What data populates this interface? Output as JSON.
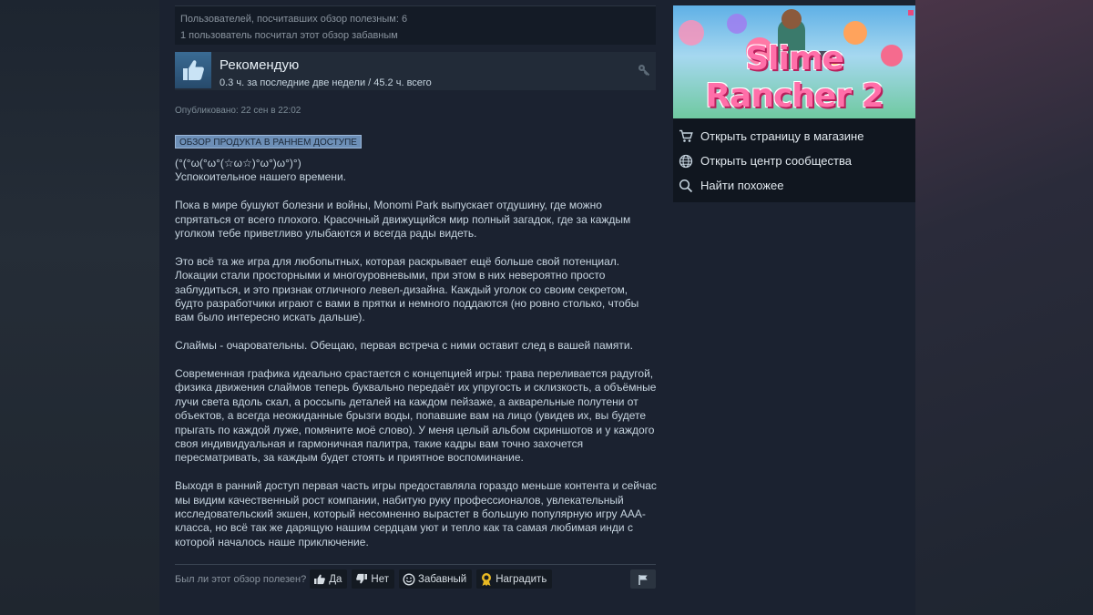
{
  "helpful": {
    "line1": "Пользователей, посчитавших обзор полезным: 6",
    "line2": "1 пользователь посчитал этот обзор забавным"
  },
  "recommendation": {
    "title": "Рекомендую",
    "hours": "0.3 ч. за последние две недели / 45.2 ч. всего",
    "thumb_icon": "thumbs-up-icon",
    "key_icon": "key-icon"
  },
  "posted": "Опубликовано: 22 сен в 22:02",
  "badge": "ОБЗОР ПРОДУКТА В РАННЕМ ДОСТУПЕ",
  "review": {
    "emote": "(°(°ω(°ω°(☆ω☆)°ω°)ω°)°)",
    "p0": "Успокоительное нашего времени.",
    "p1": "Пока в мире бушуют болезни и войны, Monomi Park выпускает отдушину, где можно спрятаться от всего плохого. Красочный движущийся мир полный загадок, где за каждым уголком тебе приветливо улыбаются и всегда рады видеть.",
    "p2": "Это всё та же игра для любопытных, которая раскрывает ещё больше свой потенциал. Локации стали просторными и многоуровневыми, при этом в них невероятно просто заблудиться, и это признак отличного левел-дизайна. Каждый уголок со своим секретом, будто разработчики играют с вами в прятки и немного поддаются (но ровно столько, чтобы вам было интересно искать дальше).",
    "p3": "Слаймы - очаровательны. Обещаю, первая встреча с ними оставит след в вашей памяти.",
    "p4": "Современная графика идеально срастается с концепцией игры: трава переливается радугой, физика движения слаймов теперь буквально передаёт их упругость и склизкость, а объёмные лучи света вдоль скал, а россыпь деталей на каждом пейзаже, а акварельные полутени от объектов, а всегда неожиданные брызги воды, попавшие вам на лицо (увидев их, вы будете прыгать по каждой луже, помяните моё слово). У меня целый альбом скриншотов и у каждого своя индивидуальная и гармоничная палитра, такие кадры вам точно захочется пересматривать, за каждым будет стоять и приятное воспоминание.",
    "p5": "Выходя в ранний доступ первая часть игры предоставляла гораздо меньше контента и сейчас мы видим качественный рост компании, набитую руку профессионалов, увлекательный исследовательский экшен, который несомненно вырастет в большую популярную игру AAA-класса, но всё так же дарящую нашим сердцам уют и тепло как та самая любимая инди с которой началось наше приключение."
  },
  "vote": {
    "question": "Был ли этот обзор полезен?",
    "yes": "Да",
    "no": "Нет",
    "funny": "Забавный",
    "award": "Наградить"
  },
  "sidebar": {
    "game_title": "Slime Rancher 2",
    "links": [
      {
        "label": "Открыть страницу в магазине",
        "icon": "cart-icon"
      },
      {
        "label": "Открыть центр сообщества",
        "icon": "globe-icon"
      },
      {
        "label": "Найти похожее",
        "icon": "search-icon"
      }
    ]
  },
  "colors": {
    "background": "#1b2838",
    "badge": "#6d8fb7",
    "accent_pink": "#ff6fa9"
  }
}
